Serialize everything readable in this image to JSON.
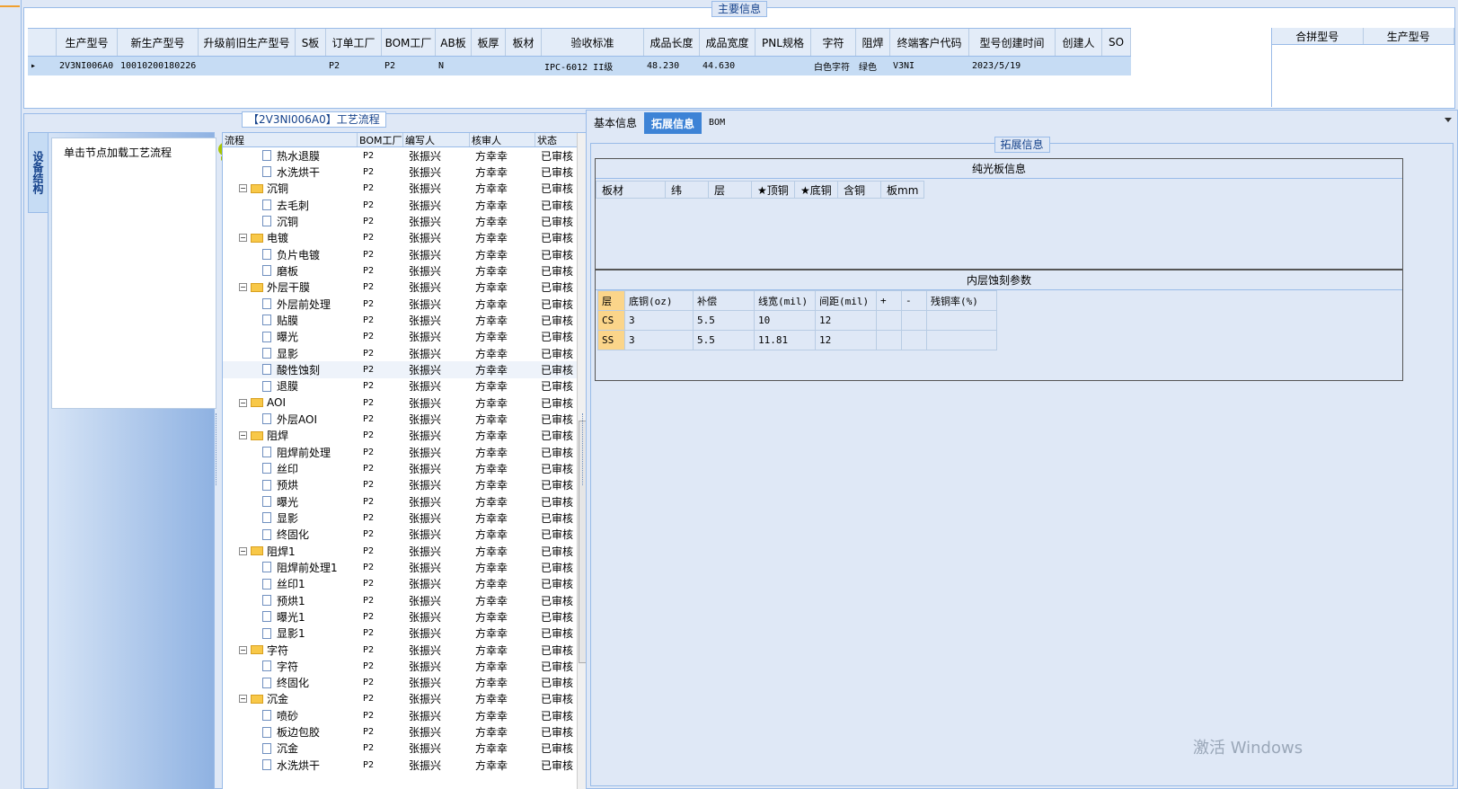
{
  "main": {
    "title": "主要信息",
    "columns": [
      "生产型号",
      "新生产型号",
      "升级前旧生产型号",
      "S板",
      "订单工厂",
      "BOM工厂",
      "AB板",
      "板厚",
      "板材",
      "验收标准",
      "成品长度",
      "成品宽度",
      "PNL规格",
      "字符",
      "阻焊",
      "终端客户代码",
      "型号创建时间",
      "创建人",
      "SO"
    ],
    "row": [
      "2V3NI006A0",
      "10010200180226",
      "",
      "",
      "P2",
      "P2",
      "N",
      "",
      "",
      "IPC-6012 II级",
      "48.230",
      "44.630",
      "",
      "白色字符",
      "绿色",
      "V3NI",
      "2023/5/19",
      "",
      ""
    ],
    "merge_columns": [
      "合拼型号",
      "生产型号"
    ]
  },
  "flow": {
    "title": "【2V3NI006A0】工艺流程",
    "side_tab": "设备结构",
    "side_hint": "单击节点加载工艺流程",
    "columns": [
      "流程",
      "BOM工厂",
      "编写人",
      "核审人",
      "状态"
    ],
    "rows": [
      {
        "name": "热水退膜",
        "level": 2,
        "bom": "P2",
        "editor": "张振兴",
        "reviewer": "方幸幸",
        "status": "已审核"
      },
      {
        "name": "水洗烘干",
        "level": 2,
        "bom": "P2",
        "editor": "张振兴",
        "reviewer": "方幸幸",
        "status": "已审核"
      },
      {
        "name": "沉铜",
        "level": 1,
        "bom": "P2",
        "editor": "张振兴",
        "reviewer": "方幸幸",
        "status": "已审核"
      },
      {
        "name": "去毛刺",
        "level": 2,
        "bom": "P2",
        "editor": "张振兴",
        "reviewer": "方幸幸",
        "status": "已审核"
      },
      {
        "name": "沉铜",
        "level": 2,
        "bom": "P2",
        "editor": "张振兴",
        "reviewer": "方幸幸",
        "status": "已审核"
      },
      {
        "name": "电镀",
        "level": 1,
        "bom": "P2",
        "editor": "张振兴",
        "reviewer": "方幸幸",
        "status": "已审核"
      },
      {
        "name": "负片电镀",
        "level": 2,
        "bom": "P2",
        "editor": "张振兴",
        "reviewer": "方幸幸",
        "status": "已审核"
      },
      {
        "name": "磨板",
        "level": 2,
        "bom": "P2",
        "editor": "张振兴",
        "reviewer": "方幸幸",
        "status": "已审核"
      },
      {
        "name": "外层干膜",
        "level": 1,
        "bom": "P2",
        "editor": "张振兴",
        "reviewer": "方幸幸",
        "status": "已审核"
      },
      {
        "name": "外层前处理",
        "level": 2,
        "bom": "P2",
        "editor": "张振兴",
        "reviewer": "方幸幸",
        "status": "已审核"
      },
      {
        "name": "贴膜",
        "level": 2,
        "bom": "P2",
        "editor": "张振兴",
        "reviewer": "方幸幸",
        "status": "已审核"
      },
      {
        "name": "曝光",
        "level": 2,
        "bom": "P2",
        "editor": "张振兴",
        "reviewer": "方幸幸",
        "status": "已审核"
      },
      {
        "name": "显影",
        "level": 2,
        "bom": "P2",
        "editor": "张振兴",
        "reviewer": "方幸幸",
        "status": "已审核"
      },
      {
        "name": "酸性蚀刻",
        "level": 2,
        "bom": "P2",
        "editor": "张振兴",
        "reviewer": "方幸幸",
        "status": "已审核",
        "selected": true
      },
      {
        "name": "退膜",
        "level": 2,
        "bom": "P2",
        "editor": "张振兴",
        "reviewer": "方幸幸",
        "status": "已审核"
      },
      {
        "name": "AOI",
        "level": 1,
        "bom": "P2",
        "editor": "张振兴",
        "reviewer": "方幸幸",
        "status": "已审核"
      },
      {
        "name": "外层AOI",
        "level": 2,
        "bom": "P2",
        "editor": "张振兴",
        "reviewer": "方幸幸",
        "status": "已审核"
      },
      {
        "name": "阻焊",
        "level": 1,
        "bom": "P2",
        "editor": "张振兴",
        "reviewer": "方幸幸",
        "status": "已审核"
      },
      {
        "name": "阻焊前处理",
        "level": 2,
        "bom": "P2",
        "editor": "张振兴",
        "reviewer": "方幸幸",
        "status": "已审核"
      },
      {
        "name": "丝印",
        "level": 2,
        "bom": "P2",
        "editor": "张振兴",
        "reviewer": "方幸幸",
        "status": "已审核"
      },
      {
        "name": "预烘",
        "level": 2,
        "bom": "P2",
        "editor": "张振兴",
        "reviewer": "方幸幸",
        "status": "已审核"
      },
      {
        "name": "曝光",
        "level": 2,
        "bom": "P2",
        "editor": "张振兴",
        "reviewer": "方幸幸",
        "status": "已审核"
      },
      {
        "name": "显影",
        "level": 2,
        "bom": "P2",
        "editor": "张振兴",
        "reviewer": "方幸幸",
        "status": "已审核"
      },
      {
        "name": "终固化",
        "level": 2,
        "bom": "P2",
        "editor": "张振兴",
        "reviewer": "方幸幸",
        "status": "已审核"
      },
      {
        "name": "阻焊1",
        "level": 1,
        "bom": "P2",
        "editor": "张振兴",
        "reviewer": "方幸幸",
        "status": "已审核"
      },
      {
        "name": "阻焊前处理1",
        "level": 2,
        "bom": "P2",
        "editor": "张振兴",
        "reviewer": "方幸幸",
        "status": "已审核"
      },
      {
        "name": "丝印1",
        "level": 2,
        "bom": "P2",
        "editor": "张振兴",
        "reviewer": "方幸幸",
        "status": "已审核"
      },
      {
        "name": "预烘1",
        "level": 2,
        "bom": "P2",
        "editor": "张振兴",
        "reviewer": "方幸幸",
        "status": "已审核"
      },
      {
        "name": "曝光1",
        "level": 2,
        "bom": "P2",
        "editor": "张振兴",
        "reviewer": "方幸幸",
        "status": "已审核"
      },
      {
        "name": "显影1",
        "level": 2,
        "bom": "P2",
        "editor": "张振兴",
        "reviewer": "方幸幸",
        "status": "已审核"
      },
      {
        "name": "字符",
        "level": 1,
        "bom": "P2",
        "editor": "张振兴",
        "reviewer": "方幸幸",
        "status": "已审核"
      },
      {
        "name": "字符",
        "level": 2,
        "bom": "P2",
        "editor": "张振兴",
        "reviewer": "方幸幸",
        "status": "已审核"
      },
      {
        "name": "终固化",
        "level": 2,
        "bom": "P2",
        "editor": "张振兴",
        "reviewer": "方幸幸",
        "status": "已审核"
      },
      {
        "name": "沉金",
        "level": 1,
        "bom": "P2",
        "editor": "张振兴",
        "reviewer": "方幸幸",
        "status": "已审核"
      },
      {
        "name": "喷砂",
        "level": 2,
        "bom": "P2",
        "editor": "张振兴",
        "reviewer": "方幸幸",
        "status": "已审核"
      },
      {
        "name": "板边包胶",
        "level": 2,
        "bom": "P2",
        "editor": "张振兴",
        "reviewer": "方幸幸",
        "status": "已审核"
      },
      {
        "name": "沉金",
        "level": 2,
        "bom": "P2",
        "editor": "张振兴",
        "reviewer": "方幸幸",
        "status": "已审核"
      },
      {
        "name": "水洗烘干",
        "level": 2,
        "bom": "P2",
        "editor": "张振兴",
        "reviewer": "方幸幸",
        "status": "已审核"
      }
    ]
  },
  "right": {
    "tabs": [
      "基本信息",
      "拓展信息",
      "BOM"
    ],
    "active_tab": 1,
    "group_title": "拓展信息",
    "bare_board": {
      "title": "纯光板信息",
      "columns": [
        "板材",
        "纬",
        "层",
        "★顶铜",
        "★底铜",
        "含铜",
        "板mm"
      ]
    },
    "etch": {
      "title": "内层蚀刻参数",
      "columns": [
        "层",
        "底铜(oz)",
        "补偿",
        "线宽(mil)",
        "间距(mil)",
        "+",
        "-",
        "残铜率(%)"
      ],
      "rows": [
        [
          "CS",
          "3",
          "5.5",
          "10",
          "12",
          "",
          "",
          ""
        ],
        [
          "SS",
          "3",
          "5.5",
          "11.81",
          "12",
          "",
          "",
          ""
        ]
      ]
    }
  },
  "watermark": "激活 Windows",
  "colors": {
    "accent": "#3d83d6",
    "selected_row": "#c6dcf4",
    "frame_bg": "#dfe8f6",
    "border": "#99bbe8"
  }
}
